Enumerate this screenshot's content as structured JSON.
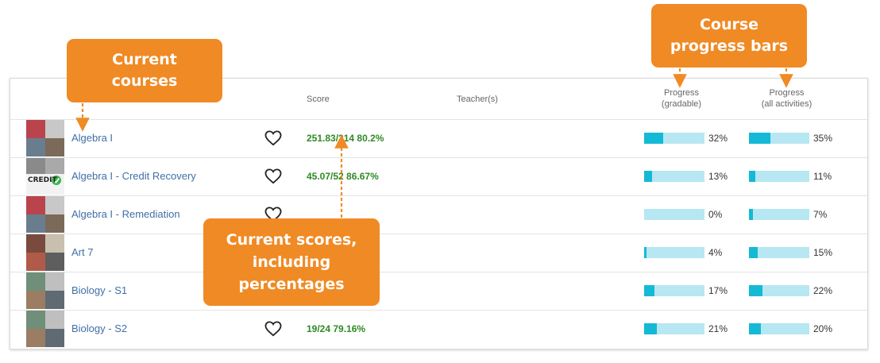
{
  "header": {
    "score": "Score",
    "teachers": "Teacher(s)",
    "progress_gradable_1": "Progress",
    "progress_gradable_2": "(gradable)",
    "progress_all_1": "Progress",
    "progress_all_2": "(all activities)"
  },
  "courses": [
    {
      "name": "Algebra I",
      "score": "251.83/314 80.2%",
      "gradable_pct": 32,
      "gradable_label": "32%",
      "all_pct": 35,
      "all_label": "35%"
    },
    {
      "name": "Algebra I - Credit Recovery",
      "score": "45.07/52 86.67%",
      "gradable_pct": 13,
      "gradable_label": "13%",
      "all_pct": 11,
      "all_label": "11%"
    },
    {
      "name": "Algebra I - Remediation",
      "score": "",
      "gradable_pct": 0,
      "gradable_label": "0%",
      "all_pct": 7,
      "all_label": "7%"
    },
    {
      "name": "Art 7",
      "score": "",
      "gradable_pct": 4,
      "gradable_label": "4%",
      "all_pct": 15,
      "all_label": "15%"
    },
    {
      "name": "Biology - S1",
      "score": "",
      "gradable_pct": 17,
      "gradable_label": "17%",
      "all_pct": 22,
      "all_label": "22%"
    },
    {
      "name": "Biology - S2",
      "score": "19/24 79.16%",
      "gradable_pct": 21,
      "gradable_label": "21%",
      "all_pct": 20,
      "all_label": "20%"
    }
  ],
  "callouts": {
    "current_courses_1": "Current",
    "current_courses_2": "courses",
    "progress_bars_1": "Course",
    "progress_bars_2": "progress bars",
    "scores_1": "Current scores,",
    "scores_2": "including",
    "scores_3": "percentages"
  },
  "icons": {
    "favorite": "heart-outline-icon",
    "credit_badge_text": "CREDIT"
  },
  "colors": {
    "callout": "#f08a24",
    "link": "#3f6fa7",
    "score": "#2f8a25",
    "bar_track": "#b7e7f2",
    "bar_fill": "#14b9d6"
  }
}
